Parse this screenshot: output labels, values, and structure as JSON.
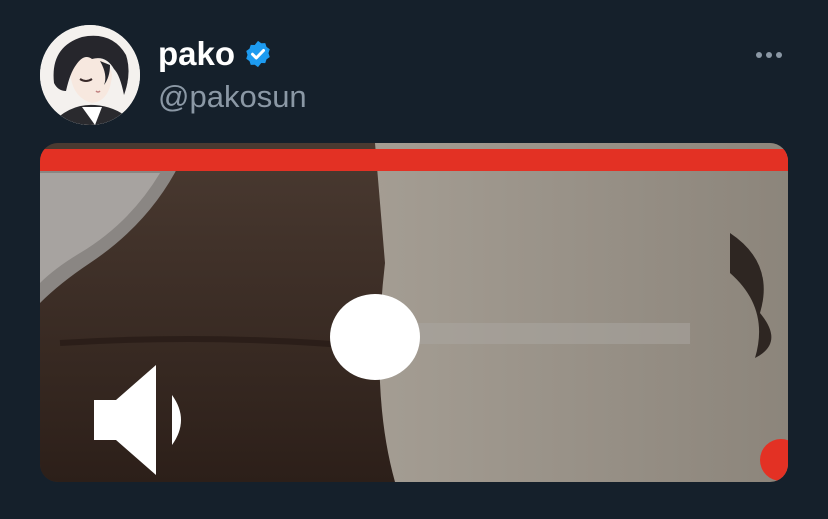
{
  "user": {
    "display_name": "pako",
    "handle": "@pakosun",
    "verified": true,
    "avatar_icon": "anime-avatar-icon"
  },
  "actions": {
    "more_icon": "more-horizontal-icon"
  },
  "media": {
    "type": "video",
    "progress_fraction": 1.0,
    "volume_fraction": 0.0,
    "speaker_icon": "volume-speaker-icon"
  },
  "colors": {
    "background": "#15202b",
    "text_primary": "#ffffff",
    "text_secondary": "#8b98a5",
    "verified_blue": "#1d9bf0",
    "progress_red": "#e33124"
  }
}
